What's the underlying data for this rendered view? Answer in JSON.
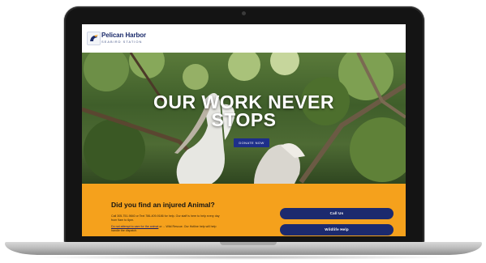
{
  "site": {
    "brand_name": "Pelican Harbor",
    "brand_sub": "SEABIRD STATION",
    "logo_icon": "pelican-logo-icon"
  },
  "hero": {
    "title_line1": "OUR WORK NEVER",
    "title_line2": "STOPS",
    "donate_label": "DONATE NOW"
  },
  "help": {
    "heading": "Did you find an injured Animal?",
    "text": "Call 305-751-9840 or Text 786-409-9186 for help. Our staff is here to help every day from 9am to 6pm.",
    "link_text": "Do not attempt to care for the animal",
    "link_rest": "or ... Wild Rescue. Our Hotline help will help handle the dispatch.",
    "call_label": "Call Us",
    "wildlife_label": "Wildlife Help"
  },
  "colors": {
    "brand_navy": "#1c2a6e",
    "band_orange": "#f5a11c"
  }
}
